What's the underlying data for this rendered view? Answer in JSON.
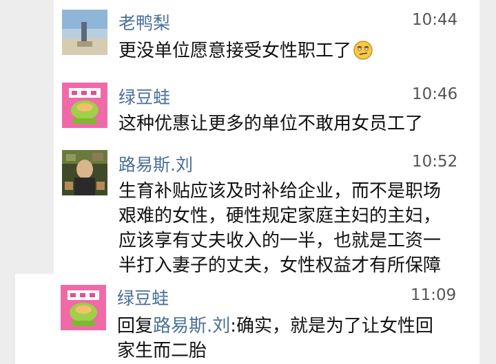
{
  "messages": [
    {
      "sender": "老鸭梨",
      "time": "10:44",
      "text": "更没单位愿意接受女性职工了",
      "emoji": "smirk-face-emoji"
    },
    {
      "sender": "绿豆蛙",
      "time": "10:46",
      "text": "这种优惠让更多的单位不敢用女员工了"
    },
    {
      "sender": "路易斯.刘",
      "time": "10:52",
      "lines": [
        "生育补贴应该及时补给企业，而不是职场",
        "艰难的女性，硬性规定家庭主妇的主妇，",
        "应该享有丈夫收入的一半，也就是工资一",
        "半打入妻子的丈夫，女性权益才有所保障"
      ]
    },
    {
      "sender": "绿豆蛙",
      "time": "11:09",
      "reply_prefix": "回复",
      "reply_to": "路易斯.刘",
      "reply_line1": ":确实，就是为了让女性回",
      "reply_line2": "家生而二胎"
    }
  ],
  "colors": {
    "name": "#4a6f9a",
    "time": "#555555",
    "text": "#111111",
    "gutter": "#ededed"
  }
}
